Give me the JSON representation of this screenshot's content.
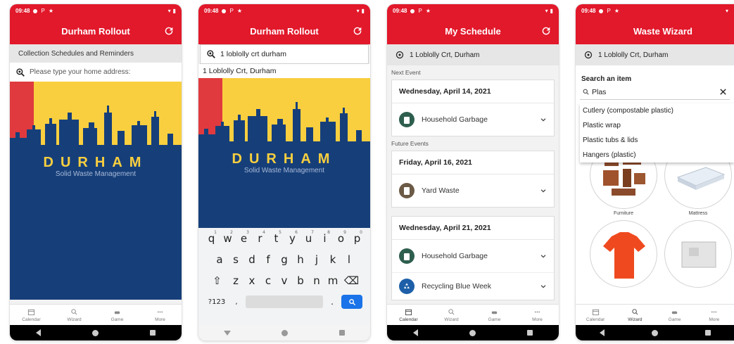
{
  "status": {
    "time": "09:48",
    "icon_p": "P",
    "icon_star": "★"
  },
  "colors": {
    "brand_red": "#e2182b",
    "gold": "#f9cf3f",
    "navy": "#163f7a"
  },
  "screen1": {
    "title": "Durham Rollout",
    "subtitle": "Collection Schedules and Reminders",
    "search_placeholder": "Please type your home address:",
    "brand": "DURHAM",
    "brand_sub": "Solid Waste Management"
  },
  "screen2": {
    "title": "Durham Rollout",
    "search_value": "1 loblolly crt durham",
    "suggestion": "1 Loblolly Crt, Durham",
    "brand": "DURHAM",
    "brand_sub": "Solid Waste Management",
    "keyboard": {
      "row1": [
        {
          "k": "q",
          "n": "1"
        },
        {
          "k": "w",
          "n": "2"
        },
        {
          "k": "e",
          "n": "3"
        },
        {
          "k": "r",
          "n": "4"
        },
        {
          "k": "t",
          "n": "5"
        },
        {
          "k": "y",
          "n": "6"
        },
        {
          "k": "u",
          "n": "7"
        },
        {
          "k": "i",
          "n": "8"
        },
        {
          "k": "o",
          "n": "9"
        },
        {
          "k": "p",
          "n": "0"
        }
      ],
      "row2": [
        "a",
        "s",
        "d",
        "f",
        "g",
        "h",
        "j",
        "k",
        "l"
      ],
      "row3": [
        "z",
        "x",
        "c",
        "v",
        "b",
        "n",
        "m"
      ],
      "shift": "⇧",
      "backspace": "⌫",
      "symbols": "?123",
      "comma": ",",
      "period": "."
    }
  },
  "screen3": {
    "title": "My Schedule",
    "address": "1 Loblolly Crt, Durham",
    "next_label": "Next Event",
    "future_label": "Future Events",
    "events": [
      {
        "date": "Wednesday, April 14, 2021",
        "items": [
          "Household Garbage"
        ]
      },
      {
        "date": "Friday, April 16, 2021",
        "items": [
          "Yard Waste"
        ]
      },
      {
        "date": "Wednesday, April 21, 2021",
        "items": [
          "Household Garbage",
          "Recycling Blue Week"
        ]
      }
    ]
  },
  "screen4": {
    "title": "Waste Wizard",
    "address": "1 Loblolly Crt, Durham",
    "search_label": "Search an item",
    "search_value": "Plas",
    "options": [
      "Cutlery (compostable plastic)",
      "Plastic wrap",
      "Plastic tubs & lids",
      "Hangers (plastic)"
    ],
    "categories": [
      "Furniture",
      "Mattress"
    ]
  },
  "nav": {
    "calendar": "Calendar",
    "wizard": "Wizard",
    "game": "Game",
    "more": "More"
  }
}
